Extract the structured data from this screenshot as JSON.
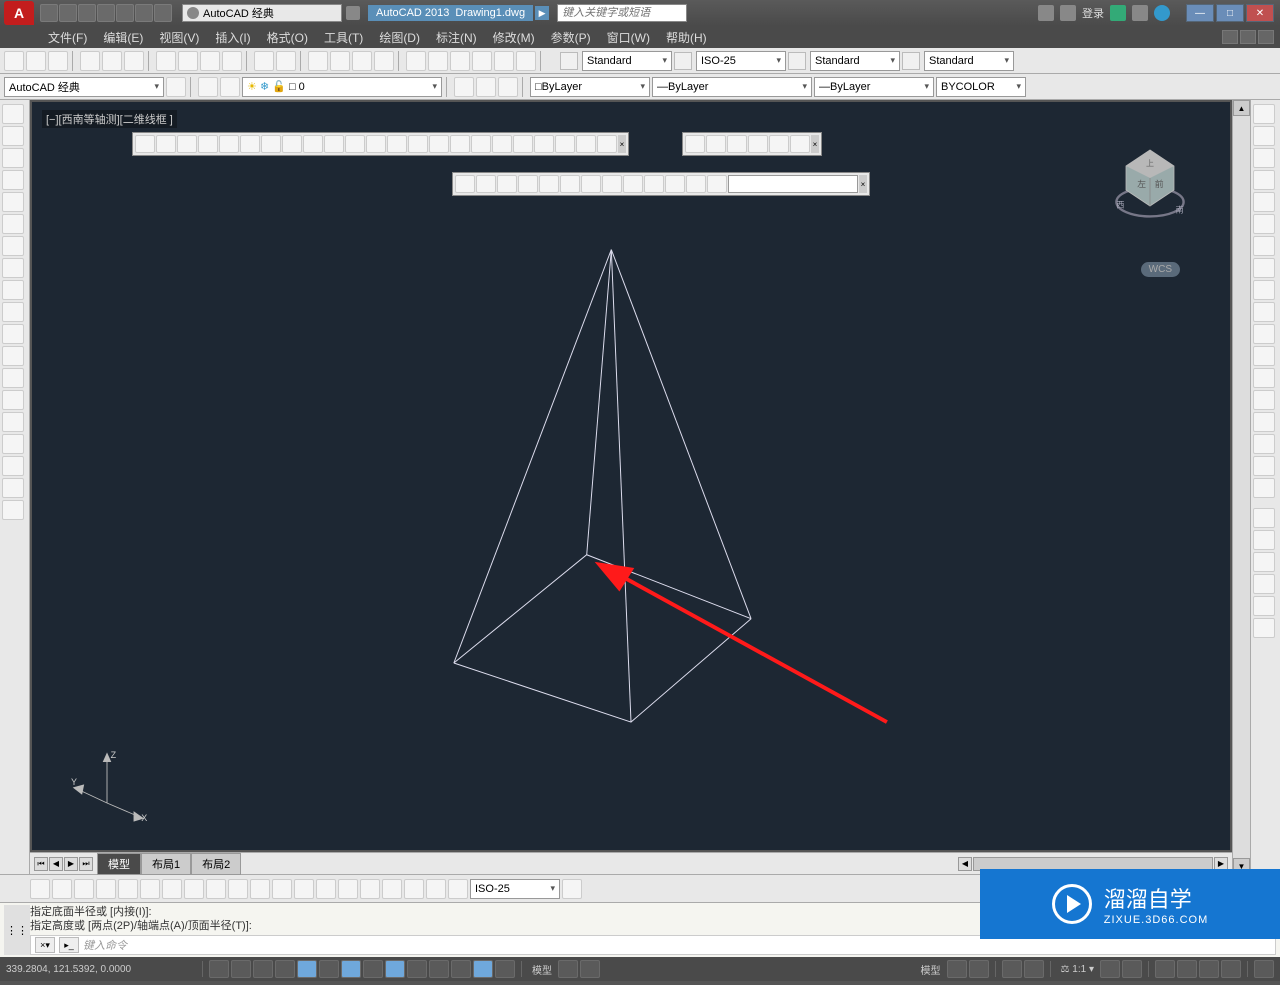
{
  "title": {
    "workspace_label": "AutoCAD 经典",
    "app": "AutoCAD 2013",
    "file": "Drawing1.dwg",
    "search_placeholder": "键入关键字或短语",
    "login": "登录"
  },
  "menu": {
    "file": "文件(F)",
    "edit": "编辑(E)",
    "view": "视图(V)",
    "insert": "插入(I)",
    "format": "格式(O)",
    "tools": "工具(T)",
    "draw": "绘图(D)",
    "dimension": "标注(N)",
    "modify": "修改(M)",
    "param": "参数(P)",
    "window": "窗口(W)",
    "help": "帮助(H)"
  },
  "row2": {
    "workspace": "AutoCAD 经典",
    "layer_state": "0",
    "layer_combo": "ByLayer",
    "linetype": "ByLayer",
    "bycolor": "BYCOLOR",
    "text_style": "Standard",
    "dim_style": "ISO-25",
    "table_style": "Standard",
    "ml_style": "Standard"
  },
  "canvas": {
    "view_label": "[−][西南等轴测][二维线框 ]",
    "wcs": "WCS",
    "cube_faces": {
      "top": "上",
      "left": "左",
      "front": "前",
      "w": "西",
      "s": "南"
    },
    "ucs": {
      "x": "X",
      "y": "Y",
      "z": "Z"
    }
  },
  "tabs": {
    "model": "模型",
    "layout1": "布局1",
    "layout2": "布局2"
  },
  "bottom_combo": "ISO-25",
  "cmd": {
    "line1": "指定底面半径或 [内接(I)]:",
    "line2": "指定高度或 [两点(2P)/轴端点(A)/顶面半径(T)]:",
    "placeholder": "键入命令"
  },
  "status": {
    "coords": "339.2804, 121.5392, 0.0000",
    "model": "模型",
    "model2": "模型",
    "scale": "1:1"
  },
  "watermark": {
    "main": "溜溜自学",
    "sub": "ZIXUE.3D66.COM"
  }
}
